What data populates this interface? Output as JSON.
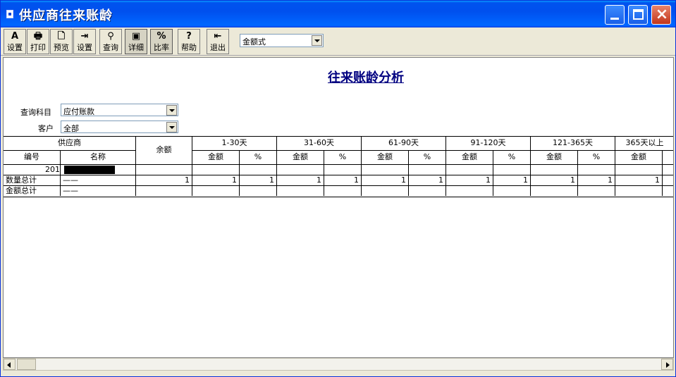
{
  "window": {
    "title": "供应商往来账龄"
  },
  "toolbar": {
    "buttons": [
      {
        "label": "设置",
        "icon": "page-setup-icon",
        "glyph": "A"
      },
      {
        "label": "打印",
        "icon": "printer-icon",
        "glyph": "🖶"
      },
      {
        "label": "预览",
        "icon": "preview-icon",
        "glyph": "🗋"
      },
      {
        "label": "设置",
        "icon": "columns-setup-icon",
        "glyph": "⇥"
      },
      {
        "label": "查询",
        "icon": "binoculars-icon",
        "glyph": "⚲"
      },
      {
        "label": "详细",
        "icon": "detail-icon",
        "glyph": "▣"
      },
      {
        "label": "比率",
        "icon": "percent-icon",
        "glyph": "%"
      },
      {
        "label": "帮助",
        "icon": "help-icon",
        "glyph": "?"
      },
      {
        "label": "退出",
        "icon": "exit-icon",
        "glyph": "⇤"
      }
    ],
    "mode_select": {
      "value": "金额式"
    }
  },
  "report": {
    "title": "往来账龄分析",
    "filters": {
      "subject_label": "查询科目",
      "subject_value": "应付账款",
      "customer_label": "客户",
      "customer_value": "全部"
    },
    "table": {
      "supplier_header": "供应商",
      "code_header": "编号",
      "name_header": "名称",
      "balance_header": "余额",
      "amount_label": "金额",
      "percent_label": "%",
      "buckets": [
        "1-30天",
        "31-60天",
        "61-90天",
        "91-120天",
        "121-365天",
        "365天以上"
      ],
      "rows": [
        {
          "code": "201",
          "name": "",
          "balance": "",
          "values": [
            "",
            "",
            "",
            "",
            "",
            "",
            "",
            "",
            "",
            "",
            ""
          ]
        },
        {
          "code": "数量总计",
          "name": "——",
          "balance": "1",
          "values": [
            "1",
            "1",
            "1",
            "1",
            "1",
            "1",
            "1",
            "1",
            "1",
            "1",
            "1"
          ]
        },
        {
          "code": "金额总计",
          "name": "——",
          "balance": "",
          "values": [
            "",
            "",
            "",
            "",
            "",
            "",
            "",
            "",
            "",
            "",
            ""
          ]
        }
      ]
    }
  },
  "colors": {
    "title_bar": "#0053ee",
    "report_title": "#000080",
    "window_face": "#ece9d8"
  }
}
